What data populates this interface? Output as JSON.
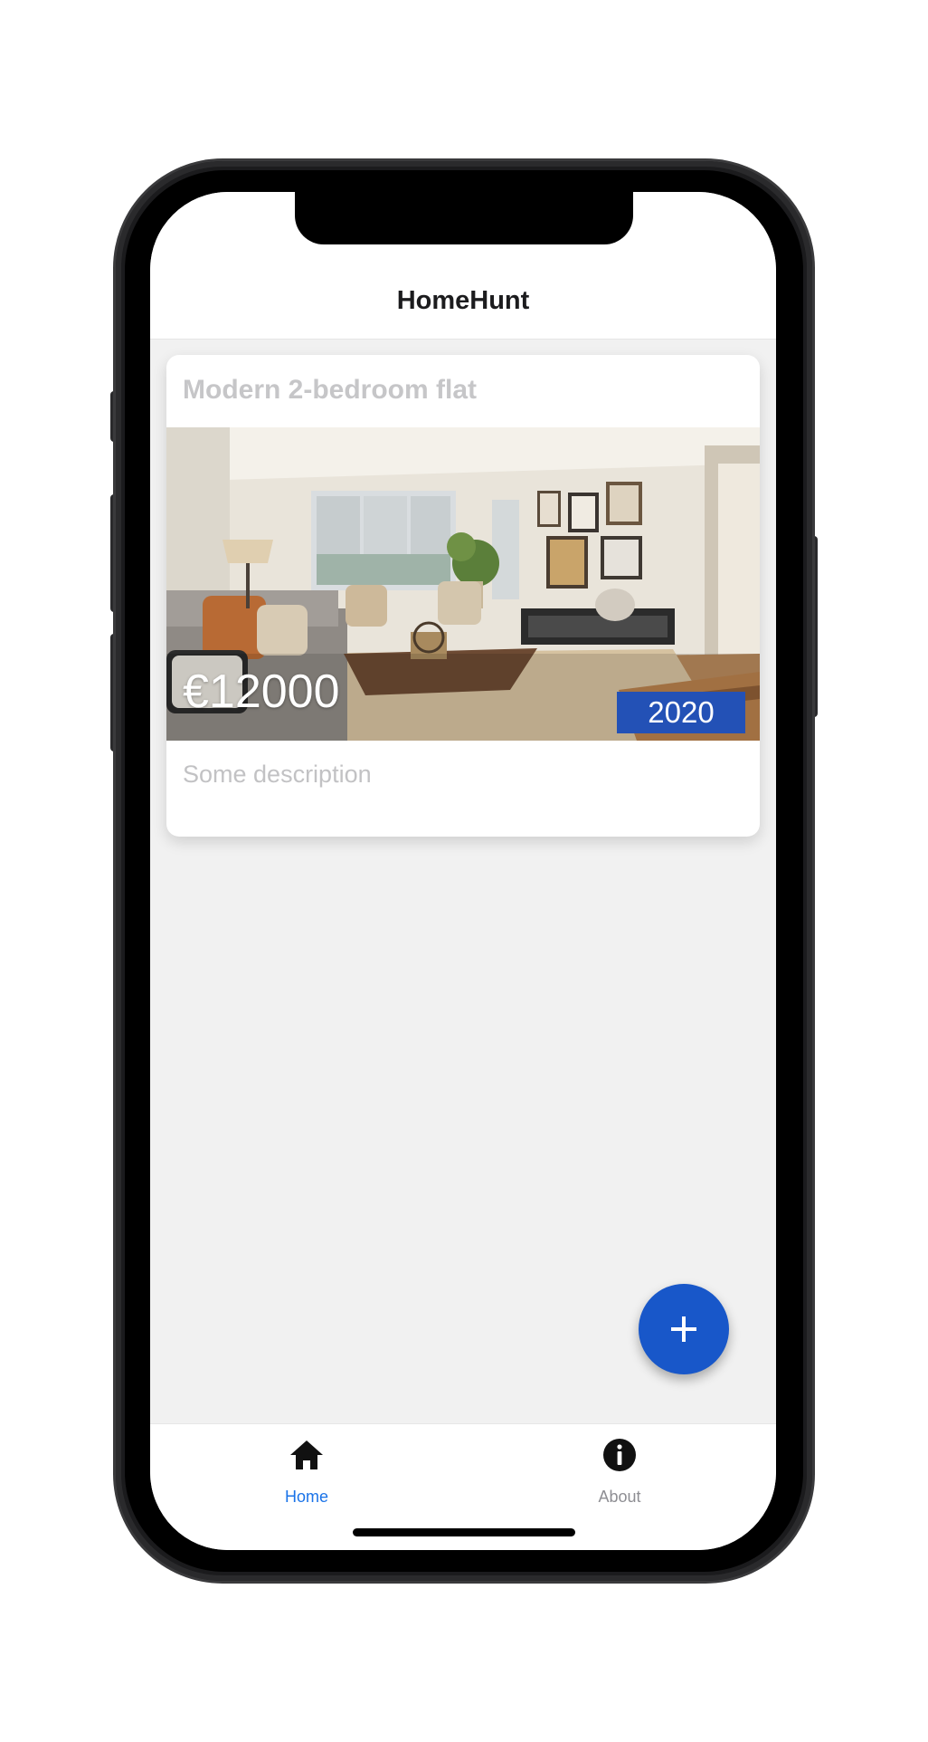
{
  "app": {
    "title": "HomeHunt"
  },
  "listing": {
    "title": "Modern 2-bedroom flat",
    "price": "€12000",
    "year": "2020",
    "description": "Some description",
    "photo_icon": "living-room-photo"
  },
  "fab": {
    "icon": "plus-icon"
  },
  "bottom_nav": {
    "items": [
      {
        "label": "Home",
        "icon": "home-icon",
        "active": true
      },
      {
        "label": "About",
        "icon": "info-icon",
        "active": false
      }
    ]
  },
  "colors": {
    "accent": "#1857c9",
    "badge": "#2351b6",
    "active_tab": "#1a73e8",
    "inactive_tab": "#8e8e93",
    "background": "#f1f1f1"
  }
}
